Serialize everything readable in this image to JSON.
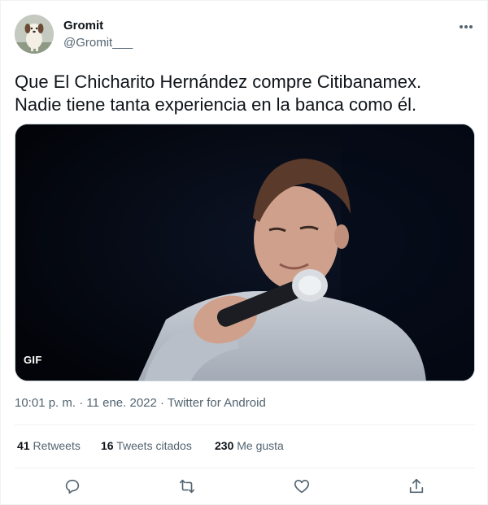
{
  "user": {
    "name": "Gromit",
    "handle": "@Gromit___"
  },
  "tweet": {
    "text_line1": "Que El Chicharito Hernández compre Citibanamex.",
    "text_line2": "Nadie tiene tanta experiencia en la banca como él."
  },
  "media": {
    "badge": "GIF"
  },
  "meta": {
    "text": "10:01 p. m. · 11 ene. 2022 · Twitter for Android"
  },
  "stats": {
    "retweets_count": "41",
    "retweets_label": "Retweets",
    "quotes_count": "16",
    "quotes_label": "Tweets citados",
    "likes_count": "230",
    "likes_label": "Me gusta"
  },
  "icons": {
    "more": "more-horizontal-icon",
    "reply": "reply-icon",
    "retweet": "retweet-icon",
    "like": "heart-icon",
    "share": "share-icon"
  },
  "colors": {
    "text_primary": "#0f1419",
    "text_secondary": "#536471",
    "divider": "#eff3f4"
  }
}
